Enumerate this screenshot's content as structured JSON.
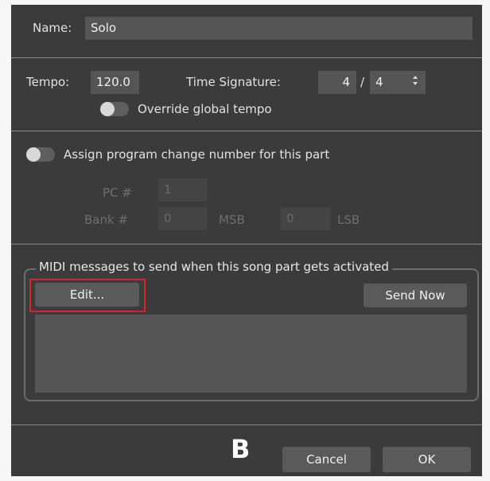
{
  "name_row": {
    "label": "Name:",
    "value": "Solo"
  },
  "tempo_row": {
    "tempo_label": "Tempo:",
    "tempo_value": "120.0",
    "ts_label": "Time Signature:",
    "ts_numerator": "4",
    "ts_divider": "/",
    "ts_denominator": "4",
    "stepper_icon": "up-down-arrows"
  },
  "override": {
    "label": "Override global tempo",
    "on": false
  },
  "program_change": {
    "label": "Assign program change number for this part",
    "on": false,
    "pc_label": "PC #",
    "pc_value": "1",
    "bank_label": "Bank #",
    "msb_value": "0",
    "msb_label": "MSB",
    "lsb_value": "0",
    "lsb_label": "LSB"
  },
  "midi_group": {
    "title": "MIDI messages to send when this song part gets activated",
    "edit_label": "Edit...",
    "send_now_label": "Send Now"
  },
  "annotation": {
    "letter": "B"
  },
  "footer": {
    "cancel_label": "Cancel",
    "ok_label": "OK"
  },
  "colors": {
    "background": "#3b3b3b",
    "field": "#555555",
    "highlight": "#d6242a"
  }
}
